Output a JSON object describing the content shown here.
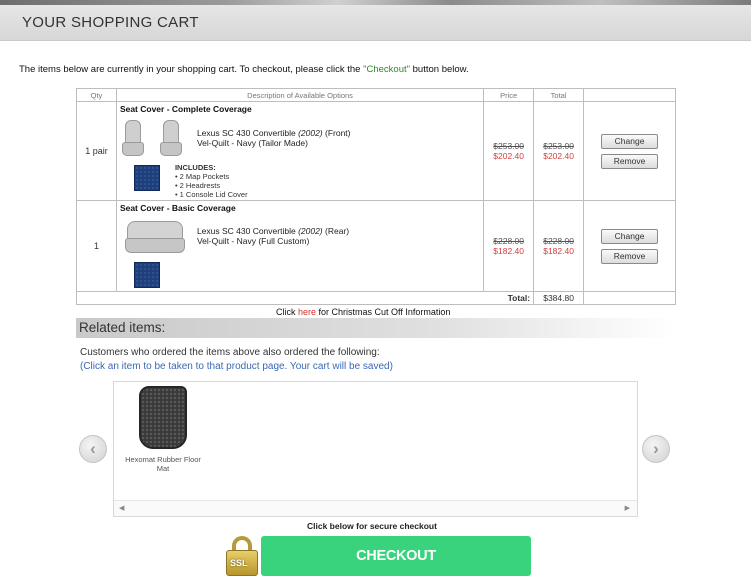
{
  "header": {
    "title": "YOUR SHOPPING CART"
  },
  "intro": {
    "before": "The items below are currently in your shopping cart. To checkout, please click the ",
    "checkout_word": "\"Checkout\"",
    "after": " button below."
  },
  "table": {
    "columns": [
      "Qty",
      "Description of Available Options",
      "Price",
      "Total",
      ""
    ],
    "items": [
      {
        "qty": "1 pair",
        "title": "Seat Cover - Complete Coverage",
        "vehicle_prefix": "Lexus SC 430 Convertible ",
        "year": "(2002)",
        "vehicle_suffix": " (Front)",
        "material": "Vel-Quilt - Navy (Tailor Made)",
        "includes_label": "INCLUDES:",
        "includes": [
          "• 2 Map Pockets",
          "• 2 Headrests",
          "• 1 Console Lid Cover"
        ],
        "price_old": "$253.00",
        "price_new": "$202.40",
        "total_old": "$253.00",
        "total_new": "$202.40",
        "swatch_color": "#1f3f78"
      },
      {
        "qty": "1",
        "title": "Seat Cover - Basic Coverage",
        "vehicle_prefix": "Lexus SC 430 Convertible ",
        "year": "(2002)",
        "vehicle_suffix": " (Rear)",
        "material": "Vel-Quilt - Navy (Full Custom)",
        "price_old": "$228.00",
        "price_new": "$182.40",
        "total_old": "$228.00",
        "total_new": "$182.40",
        "swatch_color": "#1f3f78"
      }
    ],
    "change_label": "Change",
    "remove_label": "Remove",
    "total_label": "Total:",
    "total_value": "$384.80"
  },
  "christmas": {
    "before": "Click ",
    "link": "here",
    "after": " for Christmas Cut Off Information"
  },
  "related": {
    "title": "Related items:",
    "subtitle": "Customers who ordered the items above also ordered the following:",
    "hint": "(Click an item to be taken to that product page. Your cart will be saved)",
    "items": [
      {
        "name": "Hexomat Rubber Floor Mat"
      }
    ],
    "prev_icon": "chevron-left-icon",
    "next_icon": "chevron-right-icon"
  },
  "checkout": {
    "prompt": "Click below for secure checkout",
    "ssl_label": "SSL",
    "button_label": "CHECKOUT",
    "button_color": "#39d37d"
  }
}
